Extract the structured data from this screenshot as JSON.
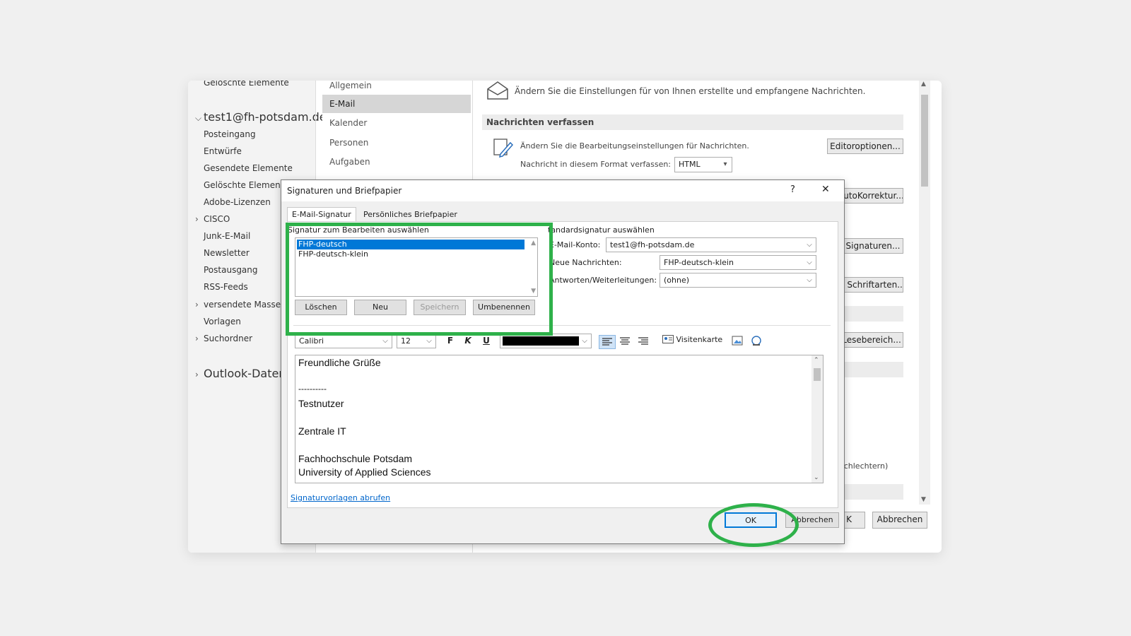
{
  "folders": {
    "top_cut": "Gelöschte Elemente",
    "account": "test1@fh-potsdam.de",
    "items": [
      "Posteingang",
      "Entwürfe",
      "Gesendete Elemente",
      "Gelöschte Elemente",
      "Adobe-Lizenzen",
      "CISCO",
      "Junk-E-Mail",
      "Newsletter",
      "Postausgang",
      "RSS-Feeds",
      "versendete Massenn",
      "Vorlagen",
      "Suchordner"
    ],
    "outlook_data": "Outlook-Datend"
  },
  "options_nav": {
    "items": [
      "Allgemein",
      "E-Mail",
      "Kalender",
      "Personen",
      "Aufgaben"
    ],
    "selected": "E-Mail"
  },
  "options_main": {
    "intro": "Ändern Sie die Einstellungen für von Ihnen erstellte und empfangene Nachrichten.",
    "section_compose": "Nachrichten verfassen",
    "edit_settings_text": "Ändern Sie die Bearbeitungseinstellungen für Nachrichten.",
    "format_label": "Nachricht in diesem Format verfassen:",
    "format_value": "HTML",
    "editor_options_button": "Editoroptionen...",
    "autokorrektur_button": "AutoKorrektur...",
    "signaturen_button": "Signaturen...",
    "schriftarten_button": "d Schriftarten...",
    "lesebereich_button": "Lesebereich...",
    "cut_text": "schlechtern)",
    "ok_partial": "K",
    "cancel_button": "Abbrechen"
  },
  "dialog": {
    "title": "Signaturen und Briefpapier",
    "help": "?",
    "close": "✕",
    "tabs": [
      "E-Mail-Signatur",
      "Persönliches Briefpapier"
    ],
    "select_label": "Signatur zum Bearbeiten auswählen",
    "signatures": [
      "FHP-deutsch",
      "FHP-deutsch-klein"
    ],
    "selected_signature": "FHP-deutsch",
    "buttons": {
      "delete": "Löschen",
      "new": "Neu",
      "save": "Speichern",
      "rename": "Umbenennen"
    },
    "default_label": "tandardsignatur auswählen",
    "account_label": "E-Mail-Konto:",
    "account_value": "test1@fh-potsdam.de",
    "new_messages_label": "Neue Nachrichten:",
    "new_messages_value": "FHP-deutsch-klein",
    "replies_label": "Antworten/Weiterleitungen:",
    "replies_value": "(ohne)",
    "font_name": "Calibri",
    "font_size": "12",
    "bold": "F",
    "italic": "K",
    "underline": "U",
    "vcard": "Visitenkarte",
    "signature_lines": [
      "Freundliche Grüße",
      "",
      "----------",
      "Testnutzer",
      "",
      "Zentrale IT",
      "",
      "Fachhochschule Potsdam",
      "University of Applied Sciences"
    ],
    "templates_link": "Signaturvorlagen abrufen",
    "ok": "OK",
    "cancel": "Abbrechen"
  },
  "colors": {
    "highlight_green": "#2eb14a",
    "selection_blue": "#0078d7",
    "link_blue": "#0066cc"
  }
}
